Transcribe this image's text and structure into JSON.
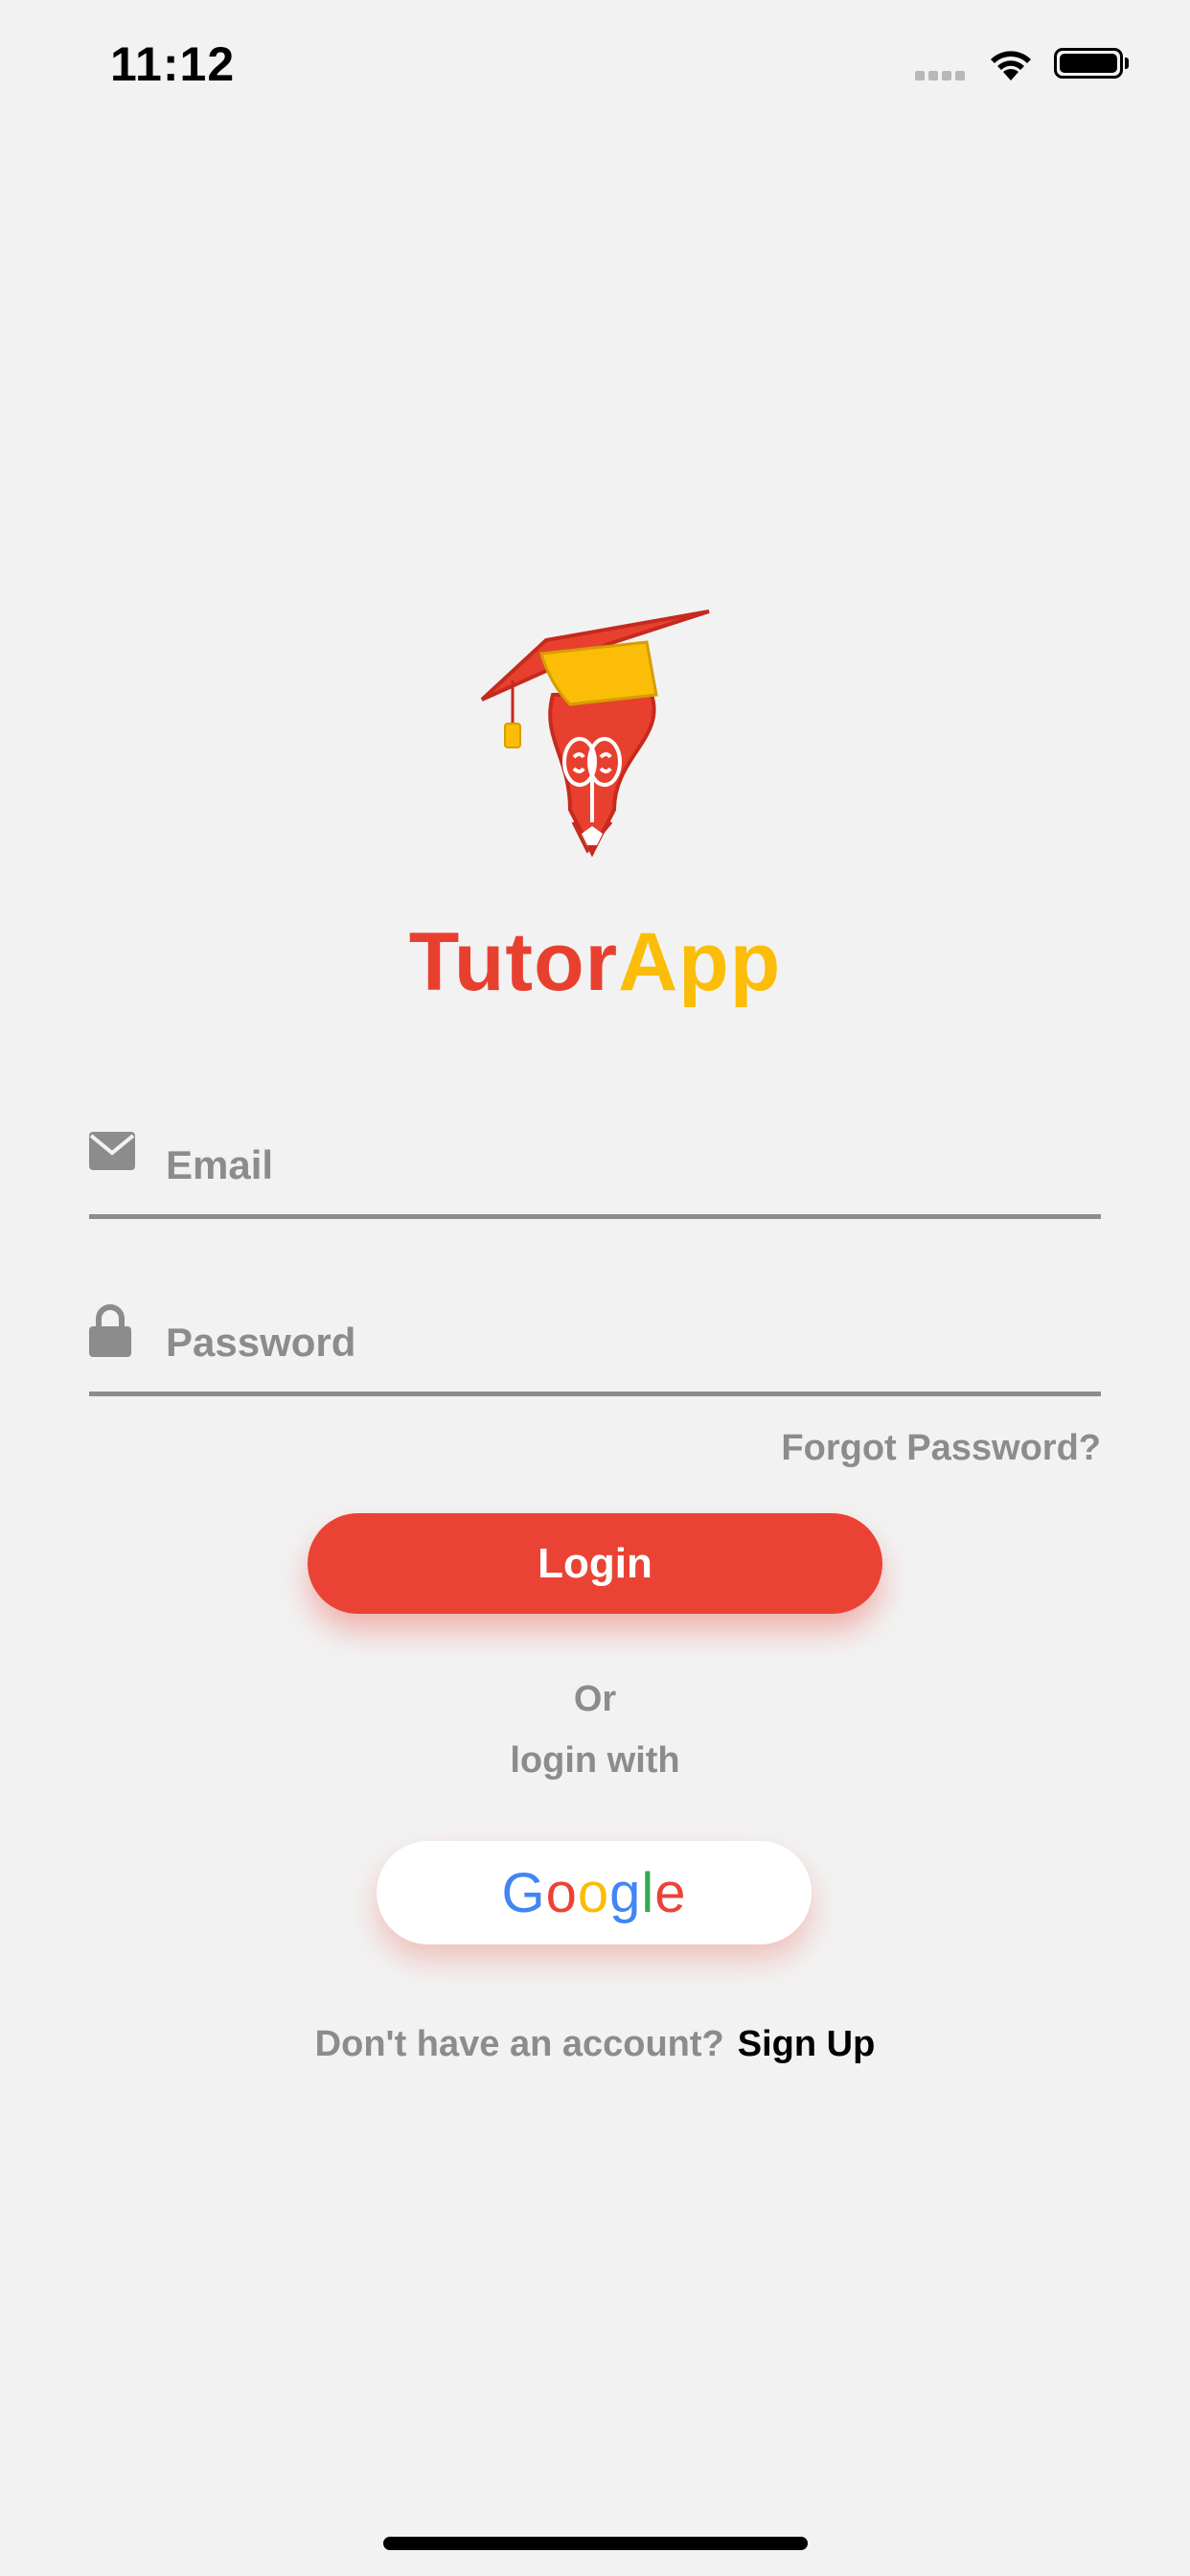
{
  "status_bar": {
    "time": "11:12"
  },
  "brand": {
    "part1": "Tutor",
    "part2": "App"
  },
  "form": {
    "email_placeholder": "Email",
    "password_placeholder": "Password",
    "forgot_label": "Forgot Password?",
    "login_label": "Login"
  },
  "alt_login": {
    "or_label": "Or",
    "login_with_label": "login with",
    "google_label": "Google"
  },
  "signup": {
    "question": "Don't have an account?",
    "link_label": "Sign Up"
  },
  "colors": {
    "accent": "#ea4335",
    "brand_yellow": "#fbbd08",
    "muted": "#8c8c8c",
    "background": "#f2f2f2"
  }
}
